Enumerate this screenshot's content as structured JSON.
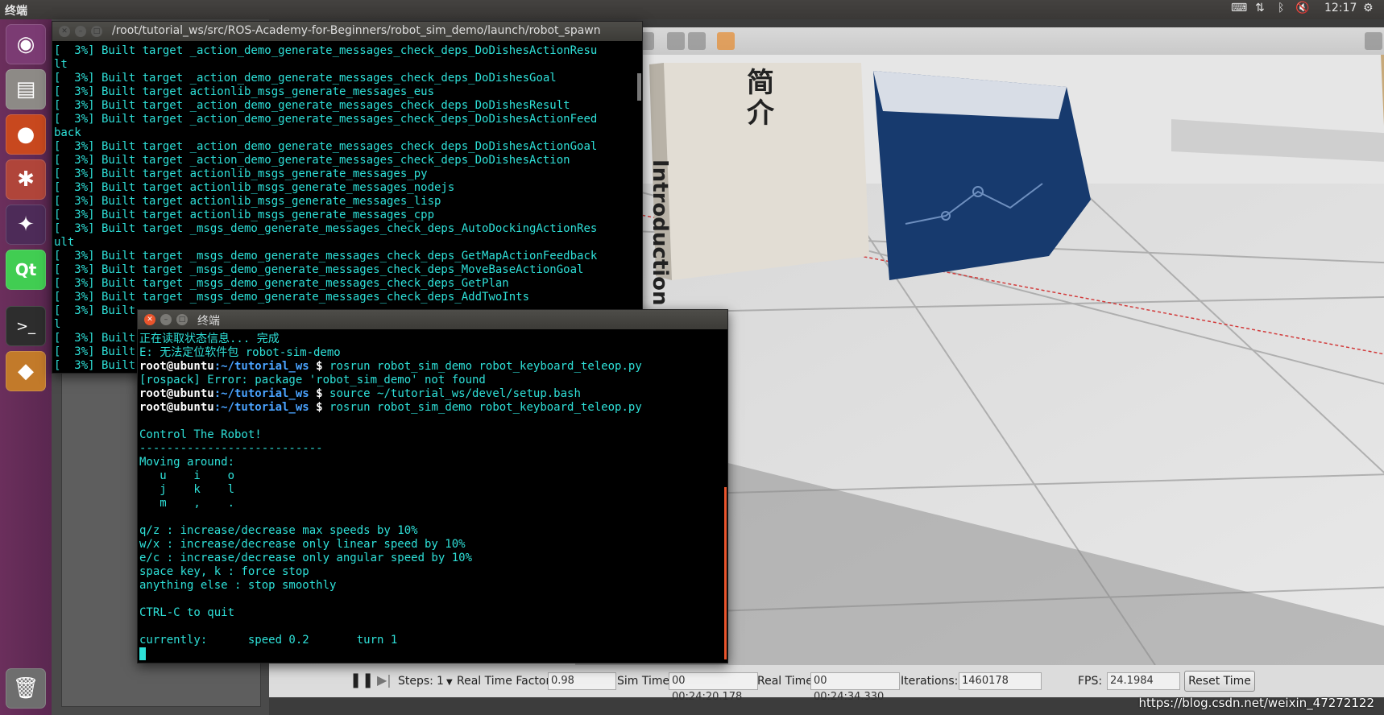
{
  "top_panel": {
    "title": "终端",
    "time": "12:17"
  },
  "gazebo": {
    "steps_label": "Steps:",
    "steps_value": "1",
    "rtf_label": "Real Time Factor:",
    "rtf_value": "0.98",
    "sim_time_label": "Sim Time:",
    "sim_time_value": "00 00:24:20.178",
    "real_time_label": "Real Time:",
    "real_time_value": "00 00:24:34.330",
    "iterations_label": "Iterations:",
    "iterations_value": "1460178",
    "fps_label": "FPS:",
    "fps_value": "24.1984",
    "reset_label": "Reset Time",
    "sign_top": "简\n介",
    "sign_side": "Introduction"
  },
  "watermark": "https://blog.csdn.net/weixin_47272122",
  "terminal_back": {
    "title": "/root/tutorial_ws/src/ROS-Academy-for-Beginners/robot_sim_demo/launch/robot_spawn",
    "lines": [
      "[  3%] Built target _action_demo_generate_messages_check_deps_DoDishesActionResu",
      "lt",
      "[  3%] Built target _action_demo_generate_messages_check_deps_DoDishesGoal",
      "[  3%] Built target actionlib_msgs_generate_messages_eus",
      "[  3%] Built target _action_demo_generate_messages_check_deps_DoDishesResult",
      "[  3%] Built target _action_demo_generate_messages_check_deps_DoDishesActionFeed",
      "back",
      "[  3%] Built target _action_demo_generate_messages_check_deps_DoDishesActionGoal",
      "[  3%] Built target _action_demo_generate_messages_check_deps_DoDishesAction",
      "[  3%] Built target actionlib_msgs_generate_messages_py",
      "[  3%] Built target actionlib_msgs_generate_messages_nodejs",
      "[  3%] Built target actionlib_msgs_generate_messages_lisp",
      "[  3%] Built target actionlib_msgs_generate_messages_cpp",
      "[  3%] Built target _msgs_demo_generate_messages_check_deps_AutoDockingActionRes",
      "ult",
      "[  3%] Built target _msgs_demo_generate_messages_check_deps_GetMapActionFeedback",
      "[  3%] Built target _msgs_demo_generate_messages_check_deps_MoveBaseActionGoal",
      "[  3%] Built target _msgs_demo_generate_messages_check_deps_GetPlan",
      "[  3%] Built target _msgs_demo_generate_messages_check_deps_AddTwoInts",
      "[  3%] Built",
      "l",
      "[  3%] Built",
      "[  3%] Built",
      "[  3%] Built"
    ]
  },
  "terminal_front": {
    "title": "终端",
    "prompt_user": "root@ubuntu",
    "prompt_path": ":~/tutorial_ws",
    "prompt_sign": " $ ",
    "line1": "正在读取状态信息... 完成",
    "line2": "E: 无法定位软件包 robot-sim-demo",
    "cmd1": "rosrun robot_sim_demo robot_keyboard_teleop.py",
    "line3": "[rospack] Error: package 'robot_sim_demo' not found",
    "cmd2": "source ~/tutorial_ws/devel/setup.bash",
    "cmd3": "rosrun robot_sim_demo robot_keyboard_teleop.py",
    "body": "\nControl The Robot!\n---------------------------\nMoving around:\n   u    i    o\n   j    k    l\n   m    ,    .\n\nq/z : increase/decrease max speeds by 10%\nw/x : increase/decrease only linear speed by 10%\ne/c : increase/decrease only angular speed by 10%\nspace key, k : force stop\nanything else : stop smoothly\n\nCTRL-C to quit\n\ncurrently:      speed 0.2       turn 1"
  }
}
